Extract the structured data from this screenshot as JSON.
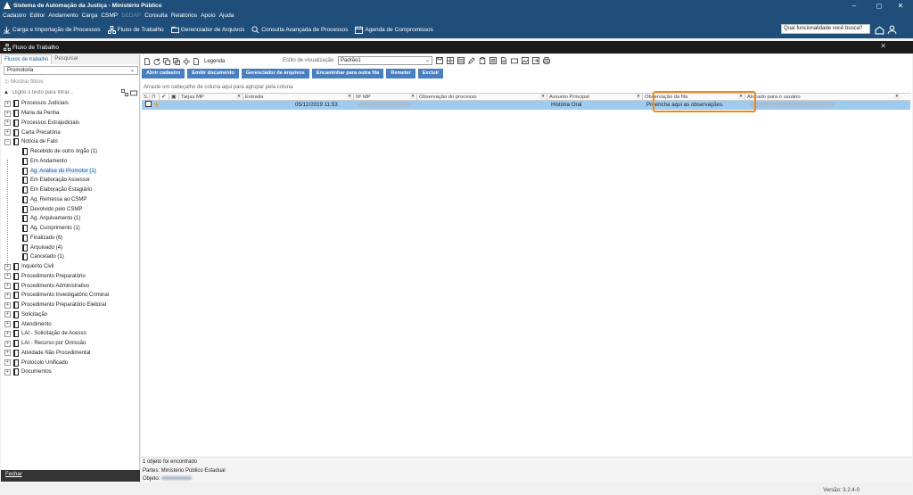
{
  "window": {
    "title": "Sistema de Automação da Justiça - Ministério Público"
  },
  "menu": [
    {
      "label": "Cadastro",
      "disabled": false
    },
    {
      "label": "Editor",
      "disabled": false
    },
    {
      "label": "Andamento",
      "disabled": false
    },
    {
      "label": "Carga",
      "disabled": false
    },
    {
      "label": "CSMP",
      "disabled": false
    },
    {
      "label": "SEDAP",
      "disabled": true
    },
    {
      "label": "Consulta",
      "disabled": false
    },
    {
      "label": "Relatórios",
      "disabled": false
    },
    {
      "label": "Apoio",
      "disabled": false
    },
    {
      "label": "Ajuda",
      "disabled": false
    }
  ],
  "toolbar": {
    "items": [
      {
        "label": "Carga e Importação de Processos",
        "icon": "download-icon"
      },
      {
        "label": "Fluxo de Trabalho",
        "icon": "workflow-icon"
      },
      {
        "label": "Gerenciador de Arquivos",
        "icon": "folder-icon"
      },
      {
        "label": "Consulta Avançada de Processos",
        "icon": "search-icon"
      },
      {
        "label": "Agenda de Compromissos",
        "icon": "calendar-icon"
      }
    ],
    "search_placeholder": "Qual funcionalidade você busca?"
  },
  "subwindow": {
    "title": "Fluxo de Trabalho"
  },
  "sidebar": {
    "tabs": [
      "Fluxos de trabalho",
      "Pesquisar"
    ],
    "combo_value": "Promotoria",
    "show_filters": "Mostrar filtros",
    "filter_placeholder": "Digite o texto para filtrar...",
    "nodes": [
      {
        "label": "Processos Judiciais",
        "level": 0,
        "expanded": false
      },
      {
        "label": "Maria da Penha",
        "level": 0,
        "expanded": false
      },
      {
        "label": "Processos Extrajudiciais",
        "level": 0,
        "expanded": false
      },
      {
        "label": "Carta Precatória",
        "level": 0,
        "expanded": false
      },
      {
        "label": "Notícia de Fato",
        "level": 0,
        "expanded": true
      },
      {
        "label": "Recebido de outro órgão (1)",
        "level": 1
      },
      {
        "label": "Em Andamento",
        "level": 1
      },
      {
        "label": "Ag. Análise do Promotor (1)",
        "level": 1,
        "selected": true
      },
      {
        "label": "Em Elaboração Assessor",
        "level": 1
      },
      {
        "label": "Em Elaboração Estagiário",
        "level": 1
      },
      {
        "label": "Ag. Remessa ao CSMP",
        "level": 1
      },
      {
        "label": "Devolvido pelo CSMP",
        "level": 1
      },
      {
        "label": "Ag. Arquivamento (1)",
        "level": 1
      },
      {
        "label": "Ag. Cumprimento (1)",
        "level": 1
      },
      {
        "label": "Finalizado (6)",
        "level": 1
      },
      {
        "label": "Arquivado (4)",
        "level": 1
      },
      {
        "label": "Cancelado (1)",
        "level": 1
      },
      {
        "label": "Inquérito Civil",
        "level": 0,
        "expanded": false
      },
      {
        "label": "Procedimento Preparatório",
        "level": 0,
        "expanded": false
      },
      {
        "label": "Procedimento Administrativo",
        "level": 0,
        "expanded": false
      },
      {
        "label": "Procedimento Investigatório Criminal",
        "level": 0,
        "expanded": false
      },
      {
        "label": "Procedimento Preparatório Eleitoral",
        "level": 0,
        "expanded": false
      },
      {
        "label": "Solicitação",
        "level": 0,
        "expanded": false
      },
      {
        "label": "Atendimento",
        "level": 0,
        "expanded": false
      },
      {
        "label": "LAI - Solicitação de Acesso",
        "level": 0,
        "expanded": false
      },
      {
        "label": "LAI - Recurso por Omissão",
        "level": 0,
        "expanded": false
      },
      {
        "label": "Atividade Não Procedimental",
        "level": 0,
        "expanded": false
      },
      {
        "label": "Protocolo Unificado",
        "level": 0,
        "expanded": false
      },
      {
        "label": "Documentos",
        "level": 0,
        "expanded": false
      }
    ],
    "exit_label": "Fechar"
  },
  "main": {
    "legend": "Legenda",
    "view_label": "Estilo de visualização",
    "view_value": "Padrão1",
    "actions": [
      "Abrir cadastro",
      "Emitir documento",
      "Gerenciador de arquivos",
      "Encaminhar para outra fila",
      "Remeter",
      "Excluir"
    ],
    "group_hint": "Arraste um cabeçalho de coluna aqui para agrupar pela coluna",
    "columns": [
      "S...",
      "",
      "",
      "",
      "Tarjas MP",
      "Entrada",
      "Nº MP",
      "Observação do processo",
      "Assunto Principal",
      "Observação da fila",
      "Alocado para o usuário"
    ],
    "row": {
      "entrada": "05/12/2019 11:53",
      "assunto": "História Oral",
      "observacao_fila": "Preencha aqui as observações."
    }
  },
  "status": {
    "found": "1 objeto foi encontrado",
    "partes": "Partes: Ministério Público Estadual",
    "objeto": "Objeto:",
    "version": "Versão: 3.2.4-0"
  },
  "colors": {
    "titlebar": "#1e4e79",
    "action_button": "#4a7fbf",
    "selected_row": "#9ecbf0",
    "highlight": "#f08a14"
  }
}
